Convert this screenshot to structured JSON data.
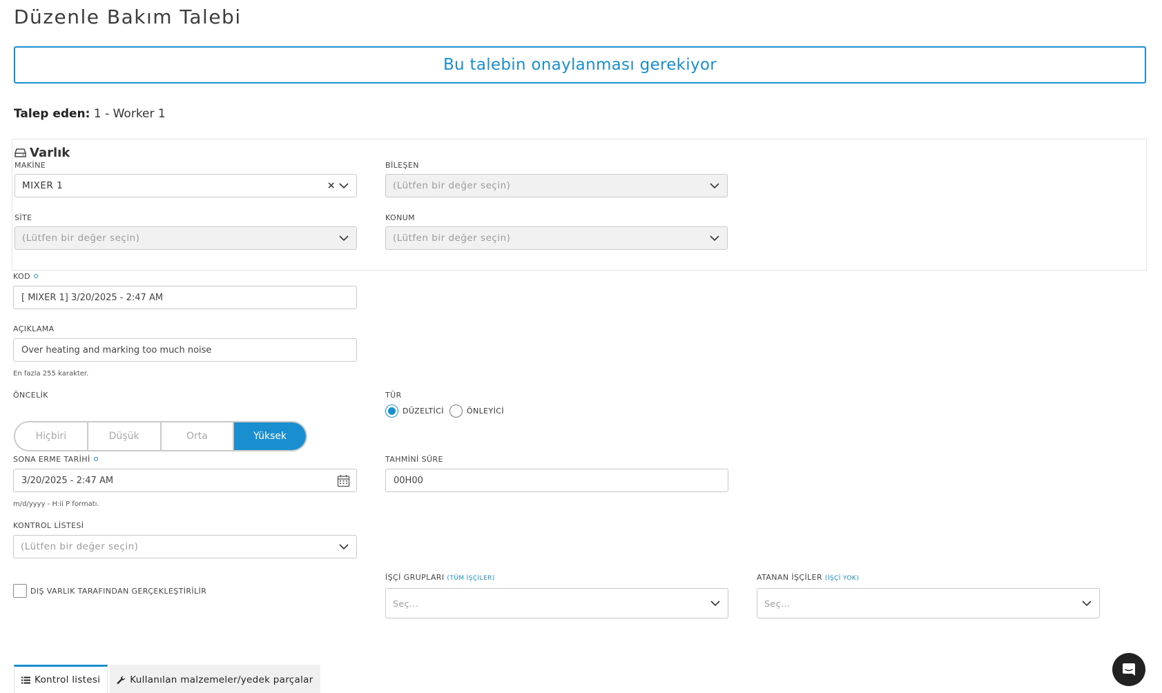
{
  "page": {
    "title": "Düzenle Bakım Talebi"
  },
  "banner": {
    "text": "Bu talebin onaylanması gerekiyor"
  },
  "requester": {
    "label": "Talep eden:",
    "value": "1 - Worker 1"
  },
  "asset": {
    "title": "Varlık",
    "machine": {
      "label": "MAKİNE",
      "value": "MIXER 1"
    },
    "component": {
      "label": "BİLEŞEN",
      "placeholder": "(Lütfen bir değer seçin)"
    },
    "site": {
      "label": "SİTE",
      "placeholder": "(Lütfen bir değer seçin)"
    },
    "location": {
      "label": "KONUM",
      "placeholder": "(Lütfen bir değer seçin)"
    }
  },
  "code": {
    "label": "KOD",
    "value": "[ MIXER 1] 3/20/2025 - 2:47 AM"
  },
  "description": {
    "label": "AÇIKLAMA",
    "value": "Over heating and marking too much noise",
    "hint": "En fazla 255 karakter."
  },
  "priority": {
    "label": "ÖNCELİK",
    "options": [
      "Hiçbiri",
      "Düşük",
      "Orta",
      "Yüksek"
    ],
    "selected": "Yüksek"
  },
  "type": {
    "label": "TÜR",
    "options": [
      "DÜZELTİCİ",
      "ÖNLEYİCİ"
    ],
    "selected": "DÜZELTİCİ"
  },
  "due_date": {
    "label": "SONA ERME TARİHİ",
    "value": "3/20/2025 - 2:47 AM",
    "hint": "m/d/yyyy - H:ii P formatı."
  },
  "estimated_duration": {
    "label": "TAHMİNİ SÜRE",
    "value": "00H00"
  },
  "checklist": {
    "label": "KONTROL LİSTESİ",
    "placeholder": "(Lütfen bir değer seçin)"
  },
  "external": {
    "label": "DIŞ VARLIK TARAFINDAN GERÇEKLEŞTİRİLİR",
    "checked": false
  },
  "worker_groups": {
    "label": "İŞÇİ GRUPLARI",
    "note": "(TÜM İŞÇİLER)",
    "placeholder": "Seç..."
  },
  "assigned_workers": {
    "label": "ATANAN İŞÇİLER",
    "note": "(İŞÇİ YOK)",
    "placeholder": "Seç..."
  },
  "tabs": [
    {
      "label": "Kontrol listesi",
      "icon": "list-icon",
      "active": true
    },
    {
      "label": "Kullanılan malzemeler/yedek parçalar",
      "icon": "wrench-icon",
      "active": false
    }
  ],
  "colors": {
    "accent": "#1a8fd0",
    "chat": "#222222"
  }
}
